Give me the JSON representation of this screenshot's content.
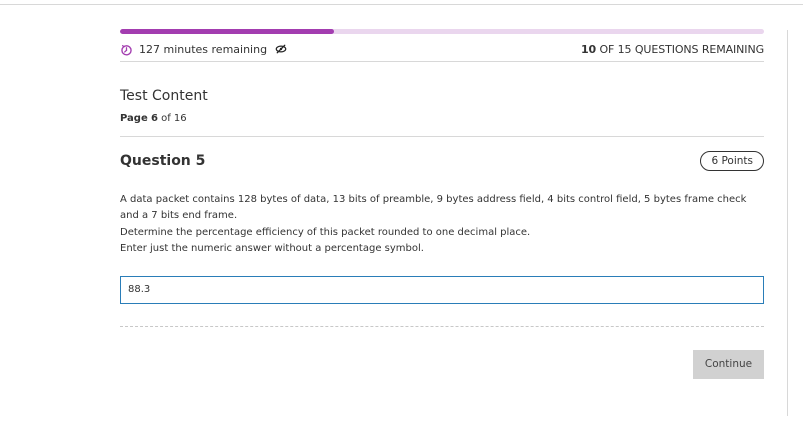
{
  "progress": {
    "fraction": 0.333,
    "fill_color": "#a33db0",
    "track_color": "#ead6ee"
  },
  "status": {
    "timer_text": "127 minutes remaining",
    "remaining_count": "10",
    "remaining_text": " OF 15 QUESTIONS REMAINING"
  },
  "section": {
    "title": "Test Content",
    "page_prefix": "Page",
    "page_number": "6",
    "page_suffix": " of 16"
  },
  "question": {
    "title": "Question 5",
    "points": "6 Points",
    "lines": [
      "A data packet contains 128 bytes of data, 13 bits of preamble, 9 bytes address field, 4 bits control field, 5 bytes frame check and a 7 bits end frame.",
      "Determine the percentage efficiency of this packet rounded to one decimal place.",
      "Enter just the numeric answer without a percentage symbol."
    ],
    "answer_value": "88.3"
  },
  "actions": {
    "continue_label": "Continue"
  },
  "colors": {
    "accent": "#a33db0",
    "input_border": "#2a7db8",
    "button_bg": "#d1d1d1"
  },
  "icons": {
    "timer": "timer-icon",
    "hide_timer": "eye-off-icon"
  }
}
